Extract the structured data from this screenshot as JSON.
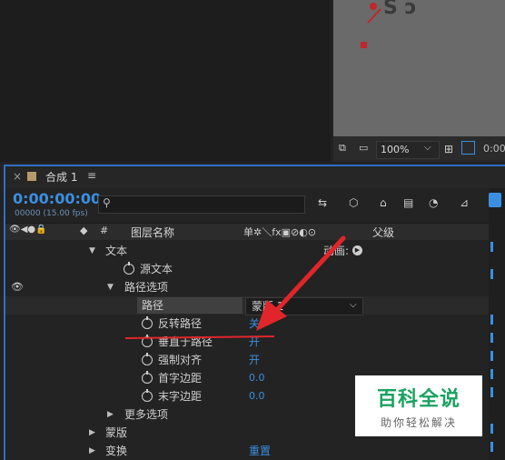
{
  "viewer": {
    "zoom": "100%"
  },
  "comp_tab": {
    "title": "合成 1"
  },
  "timecode": {
    "value": "0:00:00:00",
    "frames": "00000 (15.00 fps)"
  },
  "search": {
    "placeholder": ""
  },
  "header": {
    "hash": "#",
    "layer_name": "图层名称",
    "switch_icons": "单✲＼fx▣⊘◐⊙",
    "parent": "父级"
  },
  "rows": {
    "text": "文本",
    "animate": "动画:",
    "source_text": "源文本",
    "path_options": "路径选项",
    "path_label": "路径",
    "path_value": "蒙版 1",
    "reverse_path": "反转路径",
    "reverse_path_value": "关",
    "perpendicular": "垂直于路径",
    "perpendicular_value": "开",
    "force_align": "强制对齐",
    "force_align_value": "开",
    "first_margin": "首字边距",
    "first_margin_value": "0.0",
    "last_margin": "末字边距",
    "last_margin_value": "0.0",
    "more_options": "更多选项",
    "mask": "蒙版",
    "transform": "变换",
    "reset": "重置"
  },
  "watermark": {
    "title": "百科全说",
    "subtitle": "助你轻松解决"
  },
  "colors": {
    "accent": "#3a8fe0",
    "arrow": "#e0262a",
    "watermark_green": "#1aa260"
  }
}
